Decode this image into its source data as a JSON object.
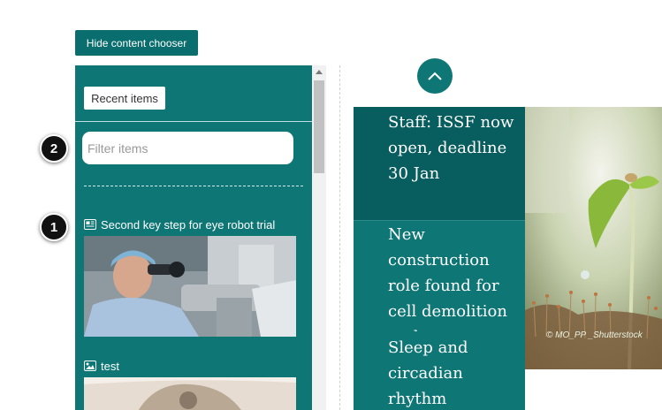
{
  "toolbar": {
    "hide_chooser_label": "Hide content chooser"
  },
  "chooser": {
    "tab_recent": "Recent items",
    "filter_placeholder": "Filter items",
    "items": [
      {
        "title": "Second key step for eye robot trial",
        "icon": "news-icon"
      },
      {
        "title": "test",
        "icon": "image-icon"
      }
    ]
  },
  "badges": [
    "2",
    "1"
  ],
  "news": [
    {
      "title": "Staff: ISSF now open, deadline 30 Jan"
    },
    {
      "title": "New construction role found for cell demolition tool"
    },
    {
      "title": "Sleep and circadian rhythm"
    }
  ],
  "hero": {
    "credit": "© MO_PP _Shutterstock"
  },
  "colors": {
    "teal": "#0f7676",
    "teal_dark": "#085e5e"
  }
}
